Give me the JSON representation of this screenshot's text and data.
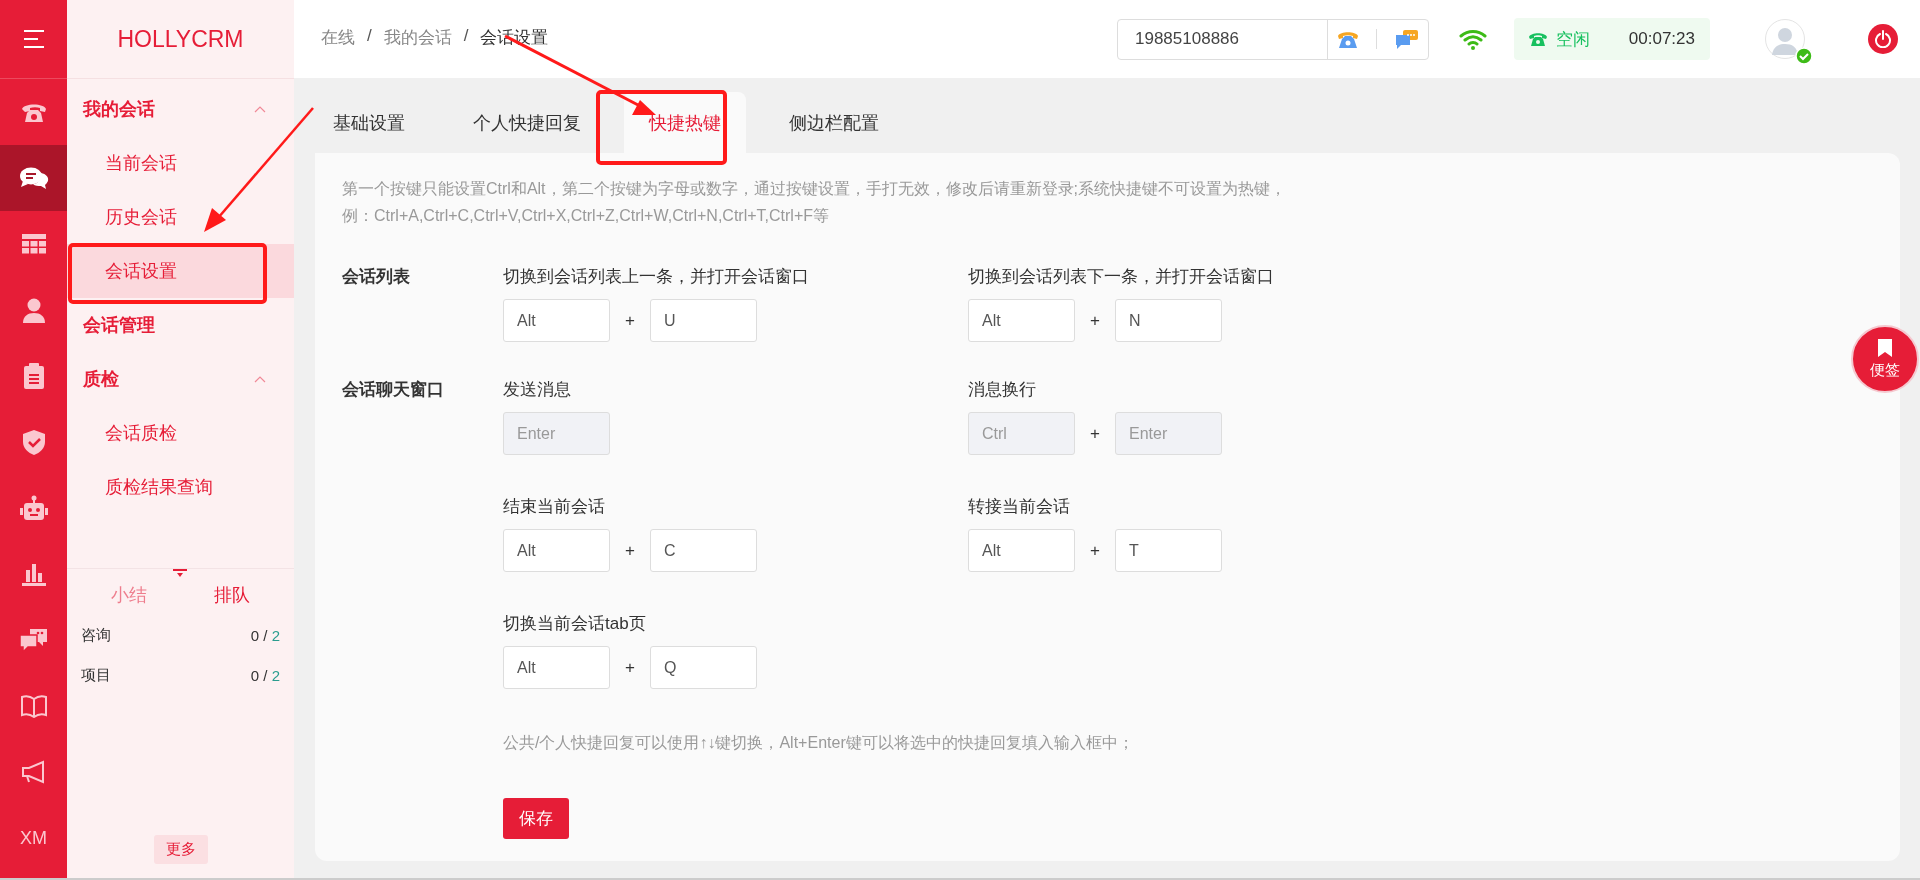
{
  "rail": [
    {
      "kind": "menu",
      "selected": false
    },
    {
      "kind": "phone",
      "selected": false
    },
    {
      "kind": "chat",
      "selected": true
    },
    {
      "kind": "grid",
      "selected": false
    },
    {
      "kind": "person",
      "selected": false
    },
    {
      "kind": "clipboard",
      "selected": false
    },
    {
      "kind": "shield",
      "selected": false
    },
    {
      "kind": "robot",
      "selected": false
    },
    {
      "kind": "chart",
      "selected": false
    },
    {
      "kind": "comments",
      "selected": false
    },
    {
      "kind": "book",
      "selected": false
    },
    {
      "kind": "megaphone",
      "selected": false
    },
    {
      "kind": "text",
      "label": "XM",
      "selected": false
    }
  ],
  "brand": "HOLLYCRM",
  "sidebar": [
    {
      "kind": "group",
      "label": "我的会话",
      "expanded": true,
      "children": [
        {
          "label": "当前会话",
          "selected": false
        },
        {
          "label": "历史会话",
          "selected": false
        },
        {
          "label": "会话设置",
          "selected": true
        }
      ]
    },
    {
      "kind": "link",
      "label": "会话管理"
    },
    {
      "kind": "group",
      "label": "质检",
      "expanded": true,
      "children": [
        {
          "label": "会话质检",
          "selected": false
        },
        {
          "label": "质检结果查询",
          "selected": false
        }
      ]
    }
  ],
  "queue": {
    "tabs": [
      {
        "label": "小结",
        "selected": false
      },
      {
        "label": "排队",
        "selected": true
      }
    ],
    "rows": [
      {
        "label": "咨询",
        "count": "0 /",
        "total": "2"
      },
      {
        "label": "项目",
        "count": "0 /",
        "total": "2"
      }
    ]
  },
  "more_button": "更多",
  "breadcrumb": [
    "在线",
    "我的会话",
    "会话设置"
  ],
  "breadcrumb_separator": "/",
  "phone_number": "19885108886",
  "status": {
    "label": "空闲",
    "timer": "00:07:23"
  },
  "avatar": {
    "online": true
  },
  "tabs": [
    {
      "label": "基础设置",
      "selected": false
    },
    {
      "label": "个人快捷回复",
      "selected": false
    },
    {
      "label": "快捷热键",
      "selected": true
    },
    {
      "label": "侧边栏配置",
      "selected": false
    }
  ],
  "hint_lines": [
    "第一个按键只能设置Ctrl和Alt，第二个按键为字母或数字，通过按键设置，手打无效，修改后请重新登录;系统快捷键不可设置为热键，",
    "例：Ctrl+A,Ctrl+C,Ctrl+V,Ctrl+X,Ctrl+Z,Ctrl+W,Ctrl+N,Ctrl+T,Ctrl+F等"
  ],
  "joiner": "+",
  "sections": [
    {
      "label": "会话列表",
      "shortcuts": [
        {
          "label": "切换到会话列表上一条，并打开会话窗口",
          "keys": [
            {
              "value": "Alt",
              "disabled": false
            },
            {
              "value": "U",
              "disabled": false
            }
          ]
        },
        {
          "label": "切换到会话列表下一条，并打开会话窗口",
          "keys": [
            {
              "value": "Alt",
              "disabled": false
            },
            {
              "value": "N",
              "disabled": false
            }
          ]
        }
      ]
    },
    {
      "label": "会话聊天窗口",
      "shortcuts": [
        {
          "label": "发送消息",
          "keys": [
            {
              "value": "Enter",
              "disabled": true
            }
          ]
        },
        {
          "label": "消息换行",
          "keys": [
            {
              "value": "Ctrl",
              "disabled": true
            },
            {
              "value": "Enter",
              "disabled": true
            }
          ]
        },
        {
          "label": "结束当前会话",
          "keys": [
            {
              "value": "Alt",
              "disabled": false
            },
            {
              "value": "C",
              "disabled": false
            }
          ]
        },
        {
          "label": "转接当前会话",
          "keys": [
            {
              "value": "Alt",
              "disabled": false
            },
            {
              "value": "T",
              "disabled": false
            }
          ]
        },
        {
          "label": "切换当前会话tab页",
          "keys": [
            {
              "value": "Alt",
              "disabled": false
            },
            {
              "value": "Q",
              "disabled": false
            }
          ]
        }
      ]
    }
  ],
  "note": "公共/个人快捷回复可以使用↑↓键切换，Alt+Enter键可以将选中的快捷回复填入输入框中；",
  "save_button": "保存",
  "float_button": "便签"
}
